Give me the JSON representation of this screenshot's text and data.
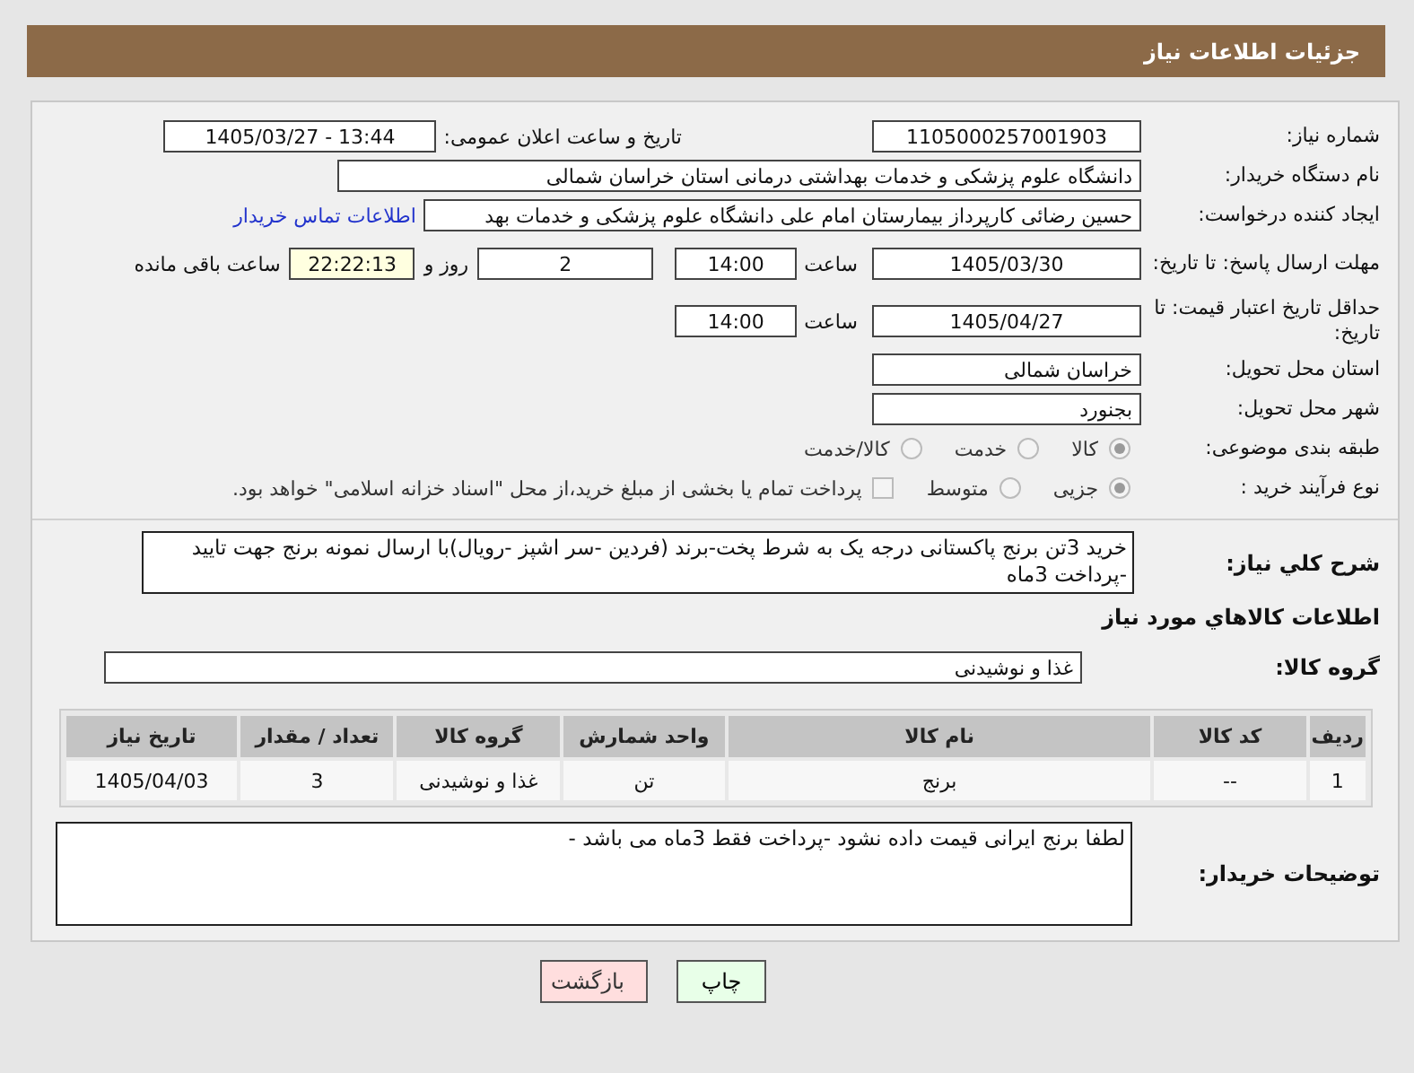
{
  "page_title": "جزئیات اطلاعات نیاز",
  "need_number": {
    "label": "شماره نیاز:",
    "value": "1105000257001903"
  },
  "announce": {
    "label": "تاریخ و ساعت اعلان عمومی:",
    "value": "1405/03/27 - 13:44"
  },
  "buyer_org": {
    "label": "نام دستگاه خریدار:",
    "value": "دانشگاه علوم پزشکی و خدمات بهداشتی درمانی استان خراسان شمالی"
  },
  "requester": {
    "label": "ایجاد کننده درخواست:",
    "value": "حسین رضائی کارپرداز بیمارستان امام علی دانشگاه علوم پزشکی و خدمات بهد",
    "link": "اطلاعات تماس خریدار"
  },
  "reply_deadline": {
    "label": "مهلت ارسال پاسخ: تا تاریخ:",
    "date": "1405/03/30",
    "time_label": "ساعت",
    "time": "14:00",
    "days": "2",
    "days_label": "روز و",
    "remaining": "22:22:13",
    "remaining_label": "ساعت باقی مانده"
  },
  "price_validity": {
    "label": "حداقل تاریخ اعتبار قیمت: تا تاریخ:",
    "date": "1405/04/27",
    "time_label": "ساعت",
    "time": "14:00"
  },
  "province": {
    "label": "استان محل تحویل:",
    "value": "خراسان شمالی"
  },
  "city": {
    "label": "شهر محل تحویل:",
    "value": "بجنورد"
  },
  "category": {
    "label": "طبقه بندی موضوعی:",
    "options": [
      {
        "label": "کالا",
        "selected": true
      },
      {
        "label": "خدمت",
        "selected": false
      },
      {
        "label": "کالا/خدمت",
        "selected": false
      }
    ]
  },
  "process": {
    "label": "نوع فرآیند خرید :",
    "options": [
      {
        "label": "جزیی",
        "selected": true
      },
      {
        "label": "متوسط",
        "selected": false
      }
    ],
    "payment": {
      "checked": false,
      "text": "پرداخت تمام یا بخشی از مبلغ خرید،از محل \"اسناد خزانه اسلامی\" خواهد بود."
    }
  },
  "description": {
    "label": "شرح کلي نیاز:",
    "value": "خرید 3تن برنج پاکستانی درجه یک به شرط پخت-برند (فردین -سر اشپز -رویال)با ارسال نمونه برنج جهت تایید -پرداخت 3ماه"
  },
  "goods_heading": "اطلاعات کالاهاي مورد نیاز",
  "goods_group": {
    "label": "گروه کالا:",
    "value": "غذا و نوشیدنی"
  },
  "table": {
    "columns": [
      "ردیف",
      "کد کالا",
      "نام کالا",
      "واحد شمارش",
      "گروه کالا",
      "تعداد / مقدار",
      "تاریخ نیاز"
    ],
    "rows": [
      [
        "1",
        "--",
        "برنج",
        "تن",
        "غذا و نوشیدنی",
        "3",
        "1405/04/03"
      ]
    ]
  },
  "buyer_notes": {
    "label": "توضیحات خریدار:",
    "value": "لطفا برنج ایرانی قیمت داده نشود -پرداخت فقط 3ماه می باشد -"
  },
  "buttons": [
    {
      "label": "چاپ",
      "kind": "print"
    },
    {
      "label": "بازگشت",
      "kind": "back"
    }
  ]
}
